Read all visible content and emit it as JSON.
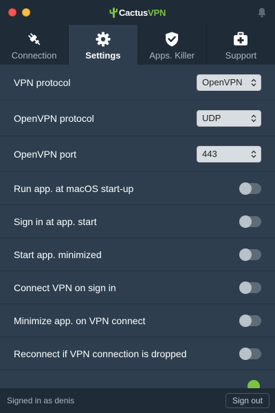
{
  "app": {
    "logo_text_1": "Cactus",
    "logo_text_2": "VPN",
    "icons": {
      "logo": "cactus-icon",
      "notifications": "bell-icon"
    },
    "colors": {
      "accent": "#7ec242",
      "background": "#2e3e4e",
      "header": "#1f2b36"
    }
  },
  "tabs": [
    {
      "label": "Connection",
      "icon": "plug-icon",
      "active": false
    },
    {
      "label": "Settings",
      "icon": "gear-icon",
      "active": true
    },
    {
      "label": "Apps. Killer",
      "icon": "shield-check-icon",
      "active": false
    },
    {
      "label": "Support",
      "icon": "first-aid-kit-icon",
      "active": false
    }
  ],
  "settings": {
    "selects": [
      {
        "label": "VPN protocol",
        "value": "OpenVPN"
      },
      {
        "label": "OpenVPN protocol",
        "value": "UDP"
      },
      {
        "label": "OpenVPN port",
        "value": "443"
      }
    ],
    "toggles": [
      {
        "label": "Run app. at macOS start-up",
        "on": false
      },
      {
        "label": "Sign in at app. start",
        "on": false
      },
      {
        "label": "Start app. minimized",
        "on": false
      },
      {
        "label": "Connect VPN on sign in",
        "on": false
      },
      {
        "label": "Minimize app. on VPN connect",
        "on": false
      },
      {
        "label": "Reconnect if VPN connection is dropped",
        "on": false
      }
    ]
  },
  "footer": {
    "signed_in_text": "Signed in as denis",
    "signout_label": "Sign out"
  }
}
